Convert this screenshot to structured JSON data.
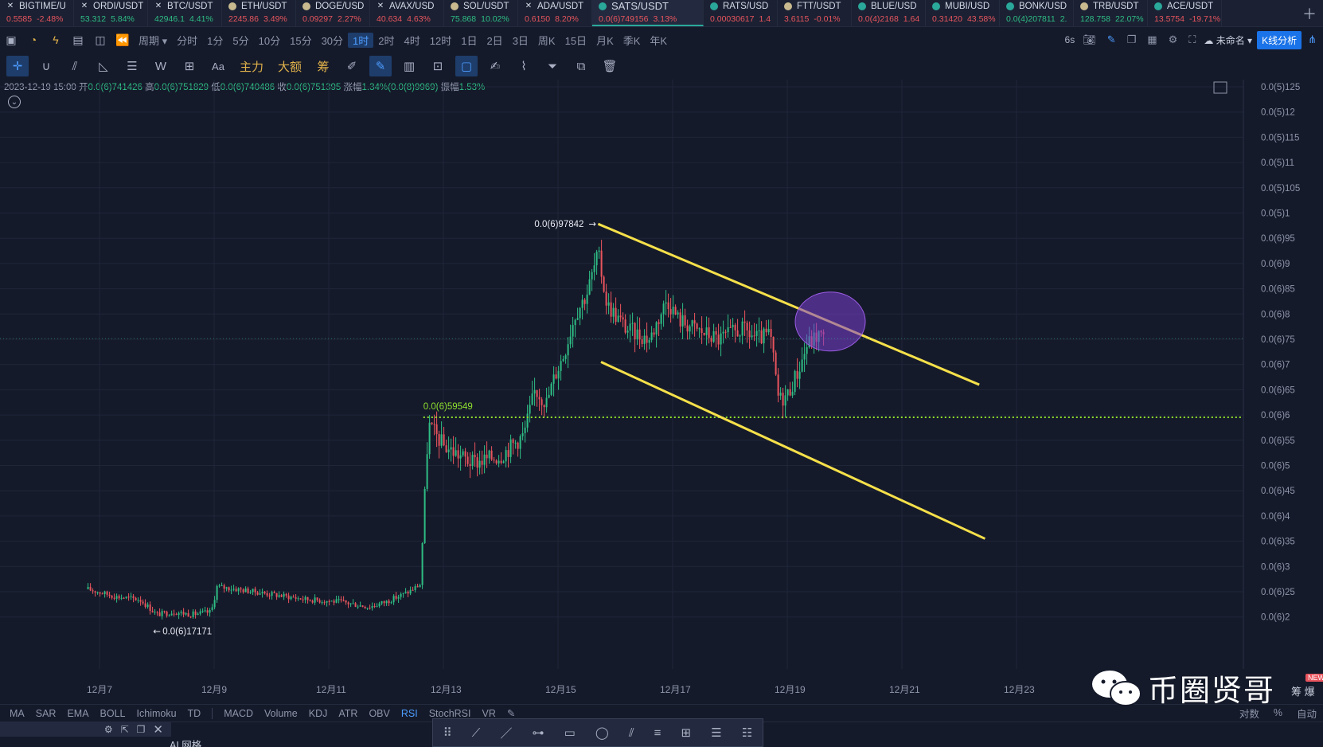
{
  "tickers": [
    {
      "icon": "x",
      "name": "BIGTIME/U",
      "price": "0.5585",
      "change": "-2.48%",
      "dir": "down"
    },
    {
      "icon": "x",
      "name": "ORDI/USDT",
      "price": "53.312",
      "change": "5.84%",
      "dir": "up"
    },
    {
      "icon": "x",
      "name": "BTC/USDT",
      "price": "42946.1",
      "change": "4.41%",
      "dir": "up"
    },
    {
      "icon": "coin",
      "name": "ETH/USDT",
      "price": "2245.86",
      "change": "3.49%",
      "dir": "down"
    },
    {
      "icon": "coin",
      "name": "DOGE/USD",
      "price": "0.09297",
      "change": "2.27%",
      "dir": "down"
    },
    {
      "icon": "x",
      "name": "AVAX/USD",
      "price": "40.634",
      "change": "4.63%",
      "dir": "down"
    },
    {
      "icon": "coin",
      "name": "SOL/USDT",
      "price": "75.868",
      "change": "10.02%",
      "dir": "up"
    },
    {
      "icon": "x",
      "name": "ADA/USDT",
      "price": "0.6150",
      "change": "8.20%",
      "dir": "down"
    },
    {
      "icon": "teal",
      "name": "SATS/USDT",
      "price": "0.0(6)749156",
      "change": "3.13%",
      "dir": "down",
      "active": true
    },
    {
      "icon": "teal",
      "name": "RATS/USD",
      "price": "0.00030617",
      "change": "1.4",
      "dir": "down"
    },
    {
      "icon": "coin",
      "name": "FTT/USDT",
      "price": "3.6115",
      "change": "-0.01%",
      "dir": "down"
    },
    {
      "icon": "teal",
      "name": "BLUE/USD",
      "price": "0.0(4)2168",
      "change": "1.64",
      "dir": "down"
    },
    {
      "icon": "teal",
      "name": "MUBI/USD",
      "price": "0.31420",
      "change": "43.58%",
      "dir": "down"
    },
    {
      "icon": "teal",
      "name": "BONK/USD",
      "price": "0.0(4)207811",
      "change": "2.",
      "dir": "up"
    },
    {
      "icon": "coin",
      "name": "TRB/USDT",
      "price": "128.758",
      "change": "22.07%",
      "dir": "up"
    },
    {
      "icon": "teal",
      "name": "ACE/USDT",
      "price": "13.5754",
      "change": "-19.71%",
      "dir": "down"
    }
  ],
  "toolbar": {
    "period_label": "周期",
    "periods": [
      "分时",
      "1分",
      "5分",
      "10分",
      "15分",
      "30分",
      "1时",
      "2时",
      "4时",
      "12时",
      "1日",
      "2日",
      "3日",
      "周K",
      "15日",
      "月K",
      "季K",
      "年K"
    ],
    "selected_period": "1时",
    "refresh": "6s",
    "layout_name": "未命名",
    "analysis_button": "K线分析"
  },
  "draw_tools": {
    "main_force": "主力",
    "big_amount": "大额",
    "chips": "筹",
    "text_tool": "Aa"
  },
  "ohlc": {
    "time": "2023-12-19 15:00",
    "open_label": "开",
    "open": "0.0(6)741426",
    "high_label": "高",
    "high": "0.0(6)751829",
    "low_label": "低",
    "low": "0.0(6)740486",
    "close_label": "收",
    "close": "0.0(6)751395",
    "change_label": "涨幅",
    "change": "1.34%(0.0(8)9969)",
    "amp_label": "振幅",
    "amp": "1.53%"
  },
  "chart_data": {
    "type": "candlestick",
    "symbol": "SATS/USDT",
    "interval": "1H",
    "price_axis_labels": [
      "0.0(5)125",
      "0.0(5)12",
      "0.0(5)115",
      "0.0(5)11",
      "0.0(5)105",
      "0.0(5)1",
      "0.0(6)95",
      "0.0(6)9",
      "0.0(6)85",
      "0.0(6)8",
      "0.0(6)75",
      "0.0(6)7",
      "0.0(6)65",
      "0.0(6)6",
      "0.0(6)55",
      "0.0(6)5",
      "0.0(6)45",
      "0.0(6)4",
      "0.0(6)35",
      "0.0(6)3",
      "0.0(6)25",
      "0.0(6)2"
    ],
    "ylim": [
      1.9e-07,
      1.25e-06
    ],
    "time_axis_labels": [
      "12月7",
      "12月9",
      "12月11",
      "12月13",
      "12月15",
      "12月17",
      "12月19",
      "12月21",
      "12月23"
    ],
    "current_price": "0.0(6)751395",
    "annotations": {
      "high_label": "0.0(6)97842",
      "low_label": "0.0(6)17171",
      "support_label": "0.0(6)59549"
    },
    "support_level": 5.9549e-07,
    "colors": {
      "up": "#2ebd85",
      "down": "#e9545d",
      "channel": "#f5e04a",
      "support": "#8ee02e",
      "highlight": "#7a3fd0"
    }
  },
  "indicators": [
    "MA",
    "SAR",
    "EMA",
    "BOLL",
    "Ichimoku",
    "TD",
    "MACD",
    "Volume",
    "KDJ",
    "ATR",
    "OBV",
    "RSI",
    "StochRSI",
    "VR"
  ],
  "selected_indicator": "RSI",
  "footer_right": {
    "log": "对数",
    "pct": "%",
    "auto": "自动"
  },
  "bottom_label": "AI 网格",
  "watermark": {
    "text": "币圈贤哥",
    "badge": "NEW",
    "side": "筹 爆"
  }
}
